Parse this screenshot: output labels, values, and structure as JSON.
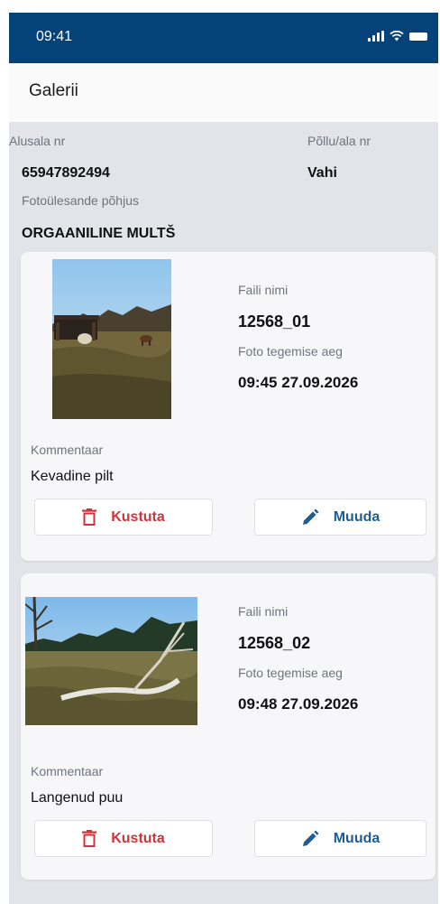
{
  "status_bar": {
    "time": "09:41"
  },
  "header": {
    "title": "Galerii"
  },
  "info": {
    "alusala_label": "Alusala nr",
    "alusala_value": "65947892494",
    "pollu_label": "Põllu/ala nr",
    "pollu_value": "Vahi",
    "reason_label": "Fotoülesande põhjus",
    "reason_value": "ORGAANILINE MULTŠ"
  },
  "photos": [
    {
      "file_label": "Faili nimi",
      "file_name": "12568_01",
      "time_label": "Foto tegemise aeg",
      "time_value": "09:45 27.09.2026",
      "comment_label": "Kommentaar",
      "comment_value": "Kevadine pilt",
      "delete_label": "Kustuta",
      "edit_label": "Muuda"
    },
    {
      "file_label": "Faili nimi",
      "file_name": "12568_02",
      "time_label": "Foto tegemise aeg",
      "time_value": "09:48 27.09.2026",
      "comment_label": "Kommentaar",
      "comment_value": "Langenud puu",
      "delete_label": "Kustuta",
      "edit_label": "Muuda"
    }
  ],
  "colors": {
    "status_bar": "#05427a",
    "delete": "#d0333a",
    "edit": "#1d5c96",
    "panel": "#e2e4e9"
  }
}
